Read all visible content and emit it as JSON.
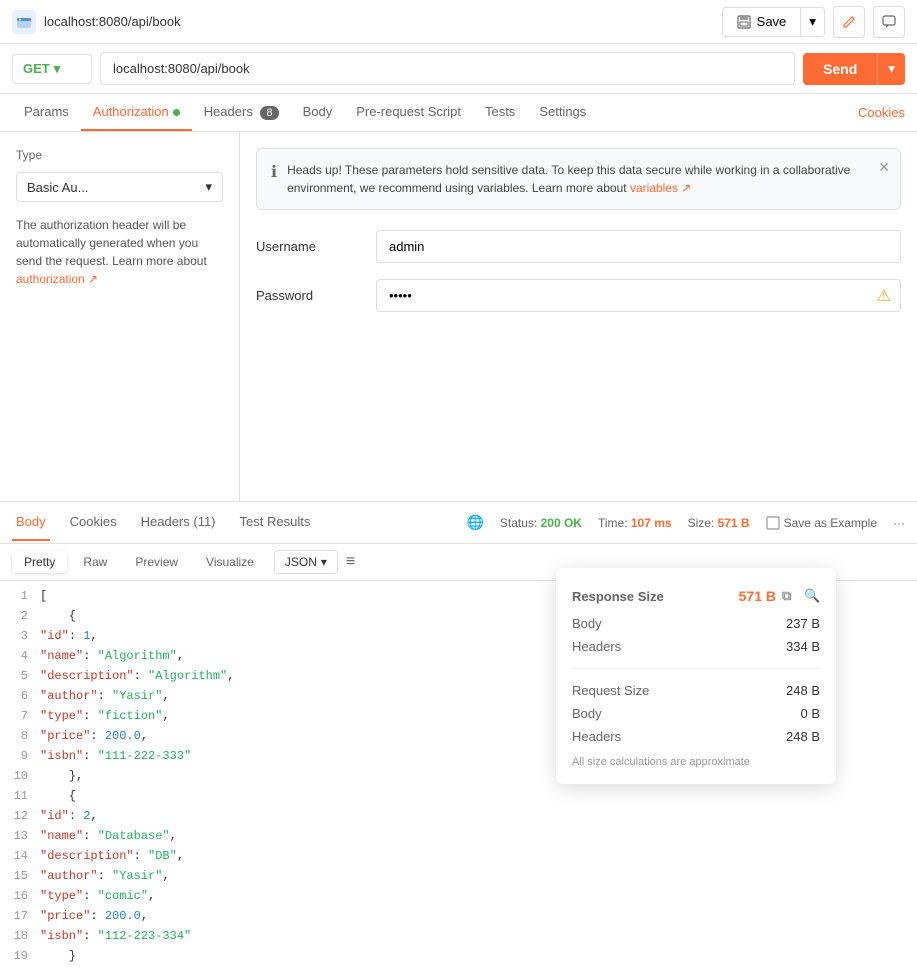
{
  "titleBar": {
    "icon": "📮",
    "title": "localhost:8080/api/book",
    "saveLabel": "Save",
    "saveBtnArrow": "▾"
  },
  "urlBar": {
    "method": "GET",
    "url": "localhost:8080/api/book",
    "sendLabel": "Send"
  },
  "tabs": {
    "items": [
      {
        "label": "Params",
        "active": false,
        "badge": null
      },
      {
        "label": "Authorization",
        "active": true,
        "badge": null,
        "dot": true
      },
      {
        "label": "Headers",
        "active": false,
        "badge": "8"
      },
      {
        "label": "Body",
        "active": false,
        "badge": null
      },
      {
        "label": "Pre-request Script",
        "active": false,
        "badge": null
      },
      {
        "label": "Tests",
        "active": false,
        "badge": null
      },
      {
        "label": "Settings",
        "active": false,
        "badge": null
      }
    ],
    "cookiesLink": "Cookies"
  },
  "authPanel": {
    "typeLabel": "Type",
    "typeValue": "Basic Au...",
    "description": "The authorization header will be automatically generated when you send the request. Learn more about",
    "authLinkText": "authorization ↗",
    "alert": {
      "text": "Heads up! These parameters hold sensitive data. To keep this data secure while working in a collaborative environment, we recommend using variables. Learn more about",
      "linkText": "variables ↗"
    },
    "fields": [
      {
        "label": "Username",
        "value": "admin",
        "hasWarning": false
      },
      {
        "label": "Password",
        "value": "admin",
        "hasWarning": true
      }
    ]
  },
  "responseTabs": {
    "items": [
      {
        "label": "Body",
        "active": true
      },
      {
        "label": "Cookies",
        "active": false
      },
      {
        "label": "Headers (11)",
        "active": false
      },
      {
        "label": "Test Results",
        "active": false
      }
    ],
    "status": "200 OK",
    "time": "107 ms",
    "size": "571 B",
    "saveExample": "Save as Example"
  },
  "formatBar": {
    "buttons": [
      "Pretty",
      "Raw",
      "Preview",
      "Visualize"
    ],
    "activeButton": "Pretty",
    "format": "JSON",
    "filterIcon": "≡"
  },
  "codeLines": [
    {
      "num": 1,
      "content": "[",
      "type": "bracket"
    },
    {
      "num": 2,
      "content": "    {",
      "type": "bracket"
    },
    {
      "num": 3,
      "content": "        \"id\": 1,",
      "parts": [
        {
          "t": "key",
          "v": "\"id\""
        },
        {
          "t": "plain",
          "v": ": "
        },
        {
          "t": "num",
          "v": "1"
        },
        {
          "t": "plain",
          "v": ","
        }
      ]
    },
    {
      "num": 4,
      "content": "        \"name\": \"Algorithm\",",
      "parts": [
        {
          "t": "key",
          "v": "\"name\""
        },
        {
          "t": "plain",
          "v": ": "
        },
        {
          "t": "str",
          "v": "\"Algorithm\""
        },
        {
          "t": "plain",
          "v": ","
        }
      ]
    },
    {
      "num": 5,
      "content": "        \"description\": \"Algorithm\",",
      "parts": [
        {
          "t": "key",
          "v": "\"description\""
        },
        {
          "t": "plain",
          "v": ": "
        },
        {
          "t": "str",
          "v": "\"Algorithm\""
        },
        {
          "t": "plain",
          "v": ","
        }
      ]
    },
    {
      "num": 6,
      "content": "        \"author\": \"Yasir\",",
      "parts": [
        {
          "t": "key",
          "v": "\"author\""
        },
        {
          "t": "plain",
          "v": ": "
        },
        {
          "t": "str",
          "v": "\"Yasir\""
        },
        {
          "t": "plain",
          "v": ","
        }
      ]
    },
    {
      "num": 7,
      "content": "        \"type\": \"fiction\",",
      "parts": [
        {
          "t": "key",
          "v": "\"type\""
        },
        {
          "t": "plain",
          "v": ": "
        },
        {
          "t": "str",
          "v": "\"fiction\""
        },
        {
          "t": "plain",
          "v": ","
        }
      ]
    },
    {
      "num": 8,
      "content": "        \"price\": 200.0,",
      "parts": [
        {
          "t": "key",
          "v": "\"price\""
        },
        {
          "t": "plain",
          "v": ": "
        },
        {
          "t": "num",
          "v": "200.0"
        },
        {
          "t": "plain",
          "v": ","
        }
      ]
    },
    {
      "num": 9,
      "content": "        \"isbn\": \"111-222-333\"",
      "parts": [
        {
          "t": "key",
          "v": "\"isbn\""
        },
        {
          "t": "plain",
          "v": ": "
        },
        {
          "t": "str",
          "v": "\"111-222-333\""
        }
      ]
    },
    {
      "num": 10,
      "content": "    },",
      "type": "bracket"
    },
    {
      "num": 11,
      "content": "    {",
      "type": "bracket"
    },
    {
      "num": 12,
      "content": "        \"id\": 2,",
      "parts": [
        {
          "t": "key",
          "v": "\"id\""
        },
        {
          "t": "plain",
          "v": ": "
        },
        {
          "t": "num",
          "v": "2"
        },
        {
          "t": "plain",
          "v": ","
        }
      ]
    },
    {
      "num": 13,
      "content": "        \"name\": \"Database\",",
      "parts": [
        {
          "t": "key",
          "v": "\"name\""
        },
        {
          "t": "plain",
          "v": ": "
        },
        {
          "t": "str",
          "v": "\"Database\""
        },
        {
          "t": "plain",
          "v": ","
        }
      ]
    },
    {
      "num": 14,
      "content": "        \"description\": \"DB\",",
      "parts": [
        {
          "t": "key",
          "v": "\"description\""
        },
        {
          "t": "plain",
          "v": ": "
        },
        {
          "t": "str",
          "v": "\"DB\""
        },
        {
          "t": "plain",
          "v": ","
        }
      ]
    },
    {
      "num": 15,
      "content": "        \"author\": \"Yasir\",",
      "parts": [
        {
          "t": "key",
          "v": "\"author\""
        },
        {
          "t": "plain",
          "v": ": "
        },
        {
          "t": "str",
          "v": "\"Yasir\""
        },
        {
          "t": "plain",
          "v": ","
        }
      ]
    },
    {
      "num": 16,
      "content": "        \"type\": \"comic\",",
      "parts": [
        {
          "t": "key",
          "v": "\"type\""
        },
        {
          "t": "plain",
          "v": ": "
        },
        {
          "t": "str",
          "v": "\"comic\""
        },
        {
          "t": "plain",
          "v": ","
        }
      ]
    },
    {
      "num": 17,
      "content": "        \"price\": 200.0,",
      "parts": [
        {
          "t": "key",
          "v": "\"price\""
        },
        {
          "t": "plain",
          "v": ": "
        },
        {
          "t": "num",
          "v": "200.0"
        },
        {
          "t": "plain",
          "v": ","
        }
      ]
    },
    {
      "num": 18,
      "content": "        \"isbn\": \"112-223-334\"",
      "parts": [
        {
          "t": "key",
          "v": "\"isbn\""
        },
        {
          "t": "plain",
          "v": ": "
        },
        {
          "t": "str",
          "v": "\"112-223-334\""
        }
      ]
    },
    {
      "num": 19,
      "content": "    }",
      "type": "bracket"
    }
  ],
  "popup": {
    "title": "Response Size",
    "titleValue": "571 B",
    "rows": [
      {
        "label": "Body",
        "value": "237 B"
      },
      {
        "label": "Headers",
        "value": "334 B"
      }
    ],
    "requestTitle": "Request Size",
    "requestValue": "248 B",
    "requestRows": [
      {
        "label": "Body",
        "value": "0 B"
      },
      {
        "label": "Headers",
        "value": "248 B"
      }
    ],
    "note": "All size calculations are approximate"
  }
}
